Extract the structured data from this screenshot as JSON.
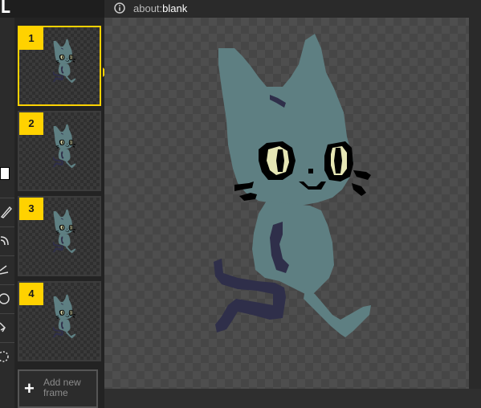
{
  "app": {
    "logo_text": "L"
  },
  "address_bar": {
    "scheme": "about:",
    "host": "blank"
  },
  "frames": [
    {
      "number": "1",
      "selected": true
    },
    {
      "number": "2",
      "selected": false
    },
    {
      "number": "3",
      "selected": false
    },
    {
      "number": "4",
      "selected": false
    }
  ],
  "add_frame": {
    "label": "Add new frame"
  },
  "tools": [
    "pen-icon",
    "spray-icon",
    "stroke-icon",
    "circle-icon",
    "pin-icon",
    "lasso-icon"
  ],
  "colors": {
    "accent": "#ffd200",
    "cat_body": "#5e7f82",
    "cat_dark": "#2f2f4a",
    "eye": "#e6e6b4",
    "outline": "#000000"
  }
}
